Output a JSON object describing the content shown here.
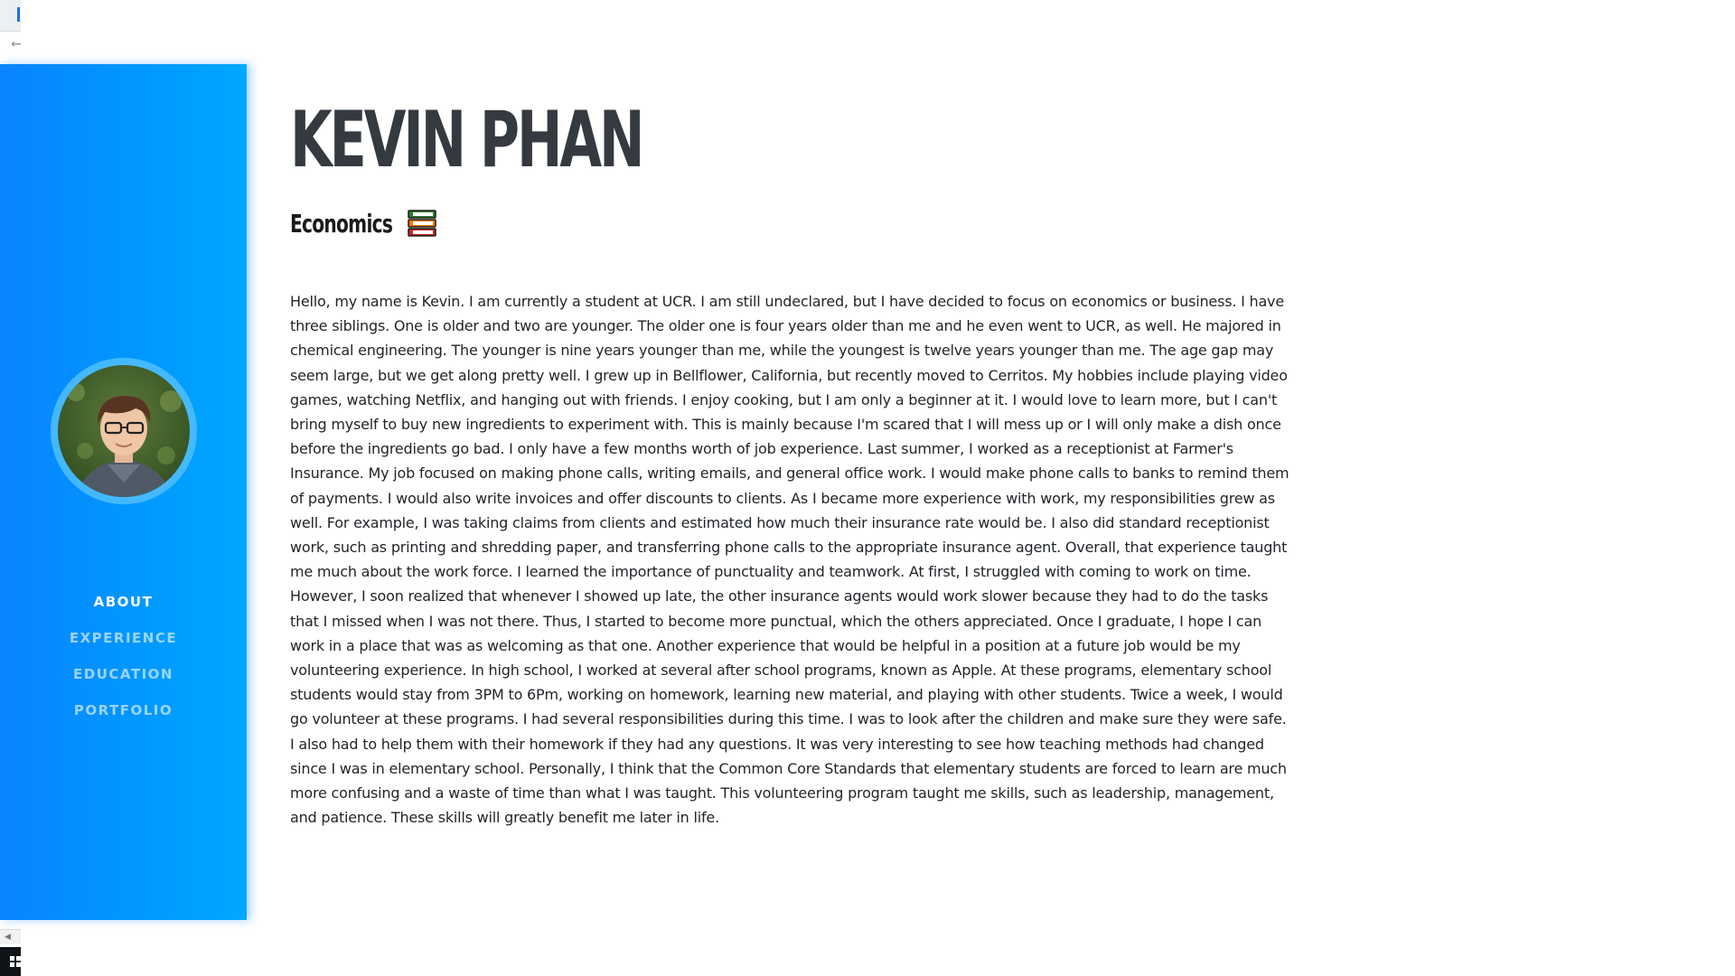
{
  "sidebar": {
    "avatar_alt": "Profile photo",
    "nav": [
      {
        "label": "ABOUT",
        "active": true
      },
      {
        "label": "EXPERIENCE",
        "active": false
      },
      {
        "label": "EDUCATION",
        "active": false
      },
      {
        "label": "PORTFOLIO",
        "active": false
      }
    ],
    "gradient_start": "#0a84ff",
    "gradient_end": "#00a8ff"
  },
  "header": {
    "name": "KEVIN PHAN",
    "subheading": "Economics",
    "subheading_icon": "books-icon"
  },
  "about": {
    "bio": "Hello, my name is Kevin. I am currently a student at UCR. I am still undeclared, but I have decided to focus on economics or business. I have three siblings. One is older and two are younger. The older one is four years older than me and he even went to UCR, as well. He majored in chemical engineering. The younger is nine years younger than me, while the youngest is twelve years younger than me. The age gap may seem large, but we get along pretty well. I grew up in Bellflower, California, but recently moved to Cerritos. My hobbies include playing video games, watching Netflix, and hanging out with friends. I enjoy cooking, but I am only a beginner at it. I would love to learn more, but I can't bring myself to buy new ingredients to experiment with. This is mainly because I'm scared that I will mess up or I will only make a dish once before the ingredients go bad. I only have a few months worth of job experience. Last summer, I worked as a receptionist at Farmer's Insurance. My job focused on making phone calls, writing emails, and general office work. I would make phone calls to banks to remind them of payments. I would also write invoices and offer discounts to clients. As I became more experience with work, my responsibilities grew as well. For example, I was taking claims from clients and estimated how much their insurance rate would be. I also did standard receptionist work, such as printing and shredding paper, and transferring phone calls to the appropriate insurance agent. Overall, that experience taught me much about the work force. I learned the importance of punctuality and teamwork. At first, I struggled with coming to work on time. However, I soon realized that whenever I showed up late, the other insurance agents would work slower because they had to do the tasks that I missed when I was not there. Thus, I started to become more punctual, which the others appreciated. Once I graduate, I hope I can work in a place that was as welcoming as that one. Another experience that would be helpful in a position at a future job would be my volunteering experience. In high school, I worked at several after school programs, known as Apple. At these programs, elementary school students would stay from 3PM to 6Pm, working on homework, learning new material, and playing with other students. Twice a week, I would go volunteer at these programs. I had several responsibilities during this time. I was to look after the children and make sure they were safe. I also had to help them with their homework if they had any questions. It was very interesting to see how teaching methods had changed since I was in elementary school. Personally, I think that the Common Core Standards that elementary students are forced to learn are much more confusing and a waste of time than what I was taught. This volunteering program taught me skills, such as leadership, management, and patience. These skills will greatly benefit me later in life."
  },
  "chrome": {
    "back_icon": "back-arrow-icon",
    "scroll_arrow_icon": "scroll-left-icon",
    "start_icon": "windows-start-icon"
  }
}
